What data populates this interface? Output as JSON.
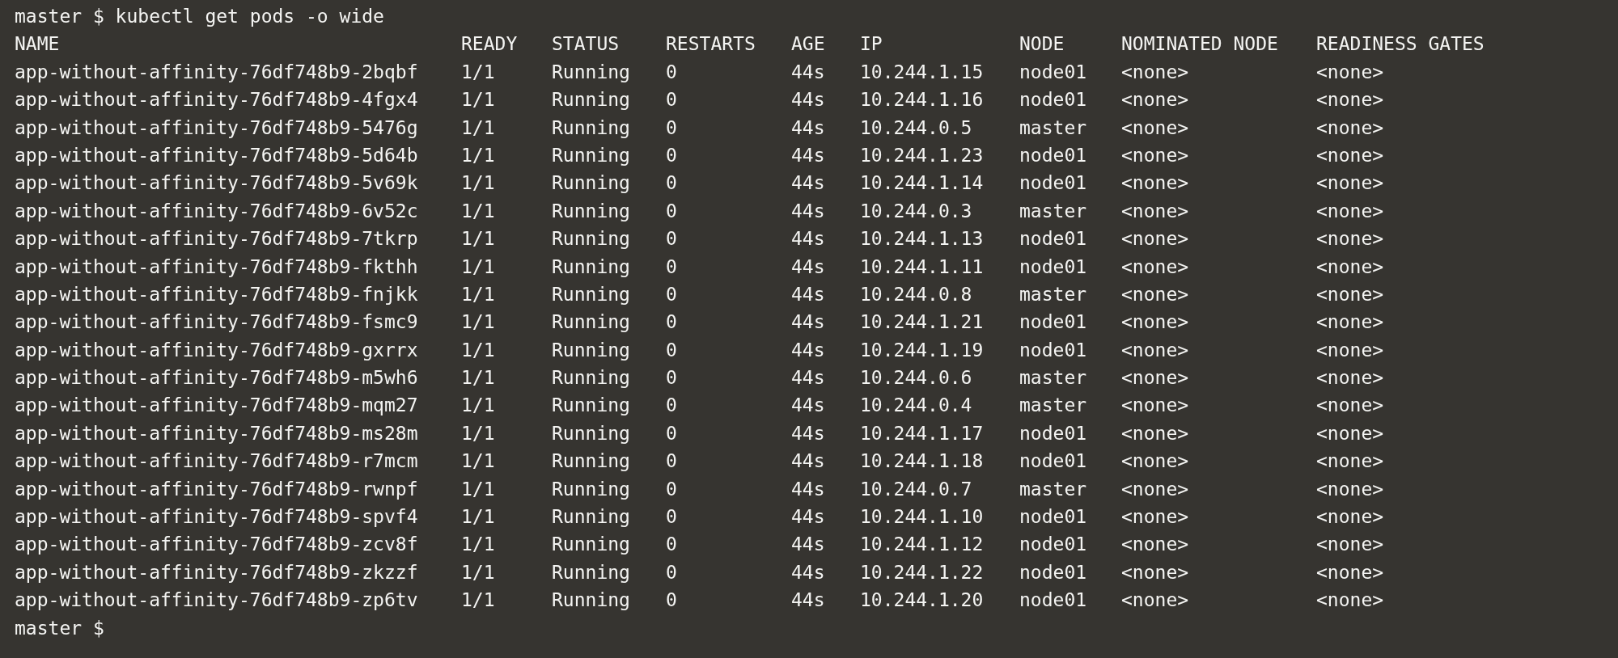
{
  "terminal": {
    "command_line": "master $ kubectl get pods -o wide",
    "table": {
      "columns": [
        "NAME",
        "READY",
        "STATUS",
        "RESTARTS",
        "AGE",
        "IP",
        "NODE",
        "NOMINATED NODE",
        "READINESS GATES"
      ],
      "rows": [
        [
          "app-without-affinity-76df748b9-2bqbf",
          "1/1",
          "Running",
          "0",
          "44s",
          "10.244.1.15",
          "node01",
          "<none>",
          "<none>"
        ],
        [
          "app-without-affinity-76df748b9-4fgx4",
          "1/1",
          "Running",
          "0",
          "44s",
          "10.244.1.16",
          "node01",
          "<none>",
          "<none>"
        ],
        [
          "app-without-affinity-76df748b9-5476g",
          "1/1",
          "Running",
          "0",
          "44s",
          "10.244.0.5",
          "master",
          "<none>",
          "<none>"
        ],
        [
          "app-without-affinity-76df748b9-5d64b",
          "1/1",
          "Running",
          "0",
          "44s",
          "10.244.1.23",
          "node01",
          "<none>",
          "<none>"
        ],
        [
          "app-without-affinity-76df748b9-5v69k",
          "1/1",
          "Running",
          "0",
          "44s",
          "10.244.1.14",
          "node01",
          "<none>",
          "<none>"
        ],
        [
          "app-without-affinity-76df748b9-6v52c",
          "1/1",
          "Running",
          "0",
          "44s",
          "10.244.0.3",
          "master",
          "<none>",
          "<none>"
        ],
        [
          "app-without-affinity-76df748b9-7tkrp",
          "1/1",
          "Running",
          "0",
          "44s",
          "10.244.1.13",
          "node01",
          "<none>",
          "<none>"
        ],
        [
          "app-without-affinity-76df748b9-fkthh",
          "1/1",
          "Running",
          "0",
          "44s",
          "10.244.1.11",
          "node01",
          "<none>",
          "<none>"
        ],
        [
          "app-without-affinity-76df748b9-fnjkk",
          "1/1",
          "Running",
          "0",
          "44s",
          "10.244.0.8",
          "master",
          "<none>",
          "<none>"
        ],
        [
          "app-without-affinity-76df748b9-fsmc9",
          "1/1",
          "Running",
          "0",
          "44s",
          "10.244.1.21",
          "node01",
          "<none>",
          "<none>"
        ],
        [
          "app-without-affinity-76df748b9-gxrrx",
          "1/1",
          "Running",
          "0",
          "44s",
          "10.244.1.19",
          "node01",
          "<none>",
          "<none>"
        ],
        [
          "app-without-affinity-76df748b9-m5wh6",
          "1/1",
          "Running",
          "0",
          "44s",
          "10.244.0.6",
          "master",
          "<none>",
          "<none>"
        ],
        [
          "app-without-affinity-76df748b9-mqm27",
          "1/1",
          "Running",
          "0",
          "44s",
          "10.244.0.4",
          "master",
          "<none>",
          "<none>"
        ],
        [
          "app-without-affinity-76df748b9-ms28m",
          "1/1",
          "Running",
          "0",
          "44s",
          "10.244.1.17",
          "node01",
          "<none>",
          "<none>"
        ],
        [
          "app-without-affinity-76df748b9-r7mcm",
          "1/1",
          "Running",
          "0",
          "44s",
          "10.244.1.18",
          "node01",
          "<none>",
          "<none>"
        ],
        [
          "app-without-affinity-76df748b9-rwnpf",
          "1/1",
          "Running",
          "0",
          "44s",
          "10.244.0.7",
          "master",
          "<none>",
          "<none>"
        ],
        [
          "app-without-affinity-76df748b9-spvf4",
          "1/1",
          "Running",
          "0",
          "44s",
          "10.244.1.10",
          "node01",
          "<none>",
          "<none>"
        ],
        [
          "app-without-affinity-76df748b9-zcv8f",
          "1/1",
          "Running",
          "0",
          "44s",
          "10.244.1.12",
          "node01",
          "<none>",
          "<none>"
        ],
        [
          "app-without-affinity-76df748b9-zkzzf",
          "1/1",
          "Running",
          "0",
          "44s",
          "10.244.1.22",
          "node01",
          "<none>",
          "<none>"
        ],
        [
          "app-without-affinity-76df748b9-zp6tv",
          "1/1",
          "Running",
          "0",
          "44s",
          "10.244.1.20",
          "node01",
          "<none>",
          "<none>"
        ]
      ]
    },
    "prompt": "master $"
  }
}
